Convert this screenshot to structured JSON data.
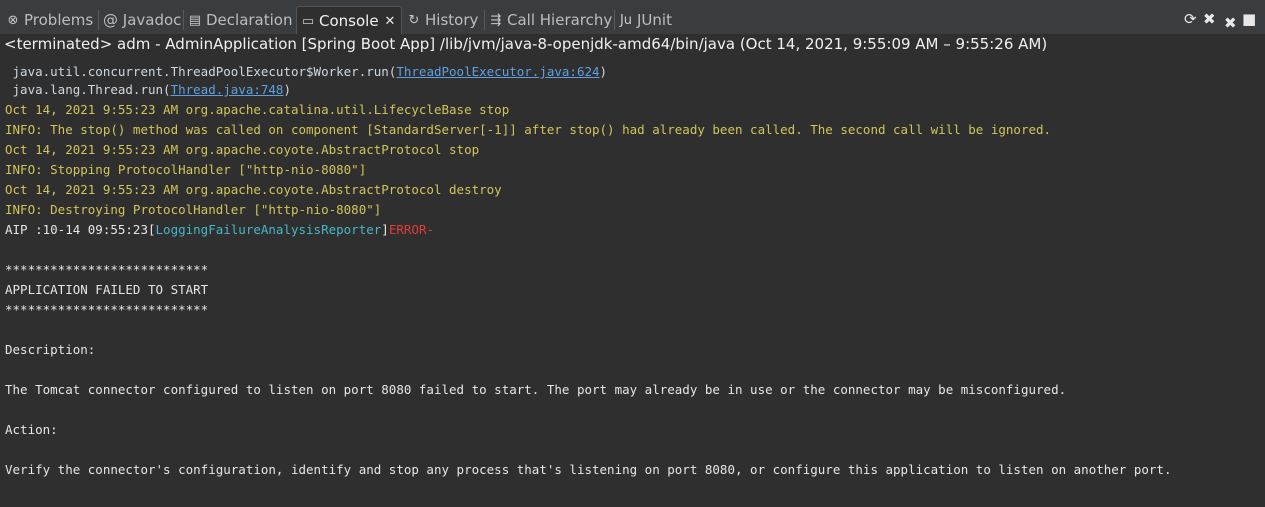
{
  "tabs": [
    {
      "label": "Problems",
      "icon": "problems-icon"
    },
    {
      "label": "@ Javadoc",
      "icon": ""
    },
    {
      "label": "Declaration",
      "icon": "declaration-icon"
    },
    {
      "label": "Console",
      "icon": "console-icon",
      "close": "✕"
    },
    {
      "label": "History",
      "icon": "history-icon"
    },
    {
      "label": "Call Hierarchy",
      "icon": "call-hierarchy-icon"
    },
    {
      "label": "JUnit",
      "icon": "junit-icon"
    }
  ],
  "toolbar": {
    "refresh": "⟳",
    "remove_launch": "✖",
    "remove_all": "✖",
    "terminate": "■"
  },
  "console_title": "<terminated> adm - AdminApplication [Spring Boot App] /lib/jvm/java-8-openjdk-amd64/bin/java  (Oct 14, 2021, 9:55:09 AM – 9:55:26 AM)",
  "lines": {
    "l0_prefix": " java.util.concurrent.ThreadPoolExecutor$Worker.run(",
    "l0_link": "ThreadPoolExecutor.java:624",
    "l0_suffix": ")",
    "l1_prefix": " java.lang.Thread.run(",
    "l1_link": "Thread.java:748",
    "l1_suffix": ")",
    "l2": "Oct 14, 2021 9:55:23 AM org.apache.catalina.util.LifecycleBase stop",
    "l3": "INFO: The stop() method was called on component [StandardServer[-1]] after stop() had already been called. The second call will be ignored.",
    "l4": "Oct 14, 2021 9:55:23 AM org.apache.coyote.AbstractProtocol stop",
    "l5": "INFO: Stopping ProtocolHandler [\"http-nio-8080\"]",
    "l6": "Oct 14, 2021 9:55:23 AM org.apache.coyote.AbstractProtocol destroy",
    "l7": "INFO: Destroying ProtocolHandler [\"http-nio-8080\"]",
    "l8_prefix": "AIP :10-14 09:55:23[",
    "l8_reporter": "LoggingFailureAnalysisReporter",
    "l8_bracket": "]",
    "l8_error": "ERROR-",
    "stars1": "***************************",
    "failed": "APPLICATION FAILED TO START",
    "stars2": "***************************",
    "description": "Description:",
    "desc_text": "The Tomcat connector configured to listen on port 8080 failed to start. The port may already be in use or the connector may be misconfigured.",
    "action": "Action:",
    "action_text": "Verify the connector's configuration, identify and stop any process that's listening on port 8080, or configure this application to listen on another port."
  }
}
